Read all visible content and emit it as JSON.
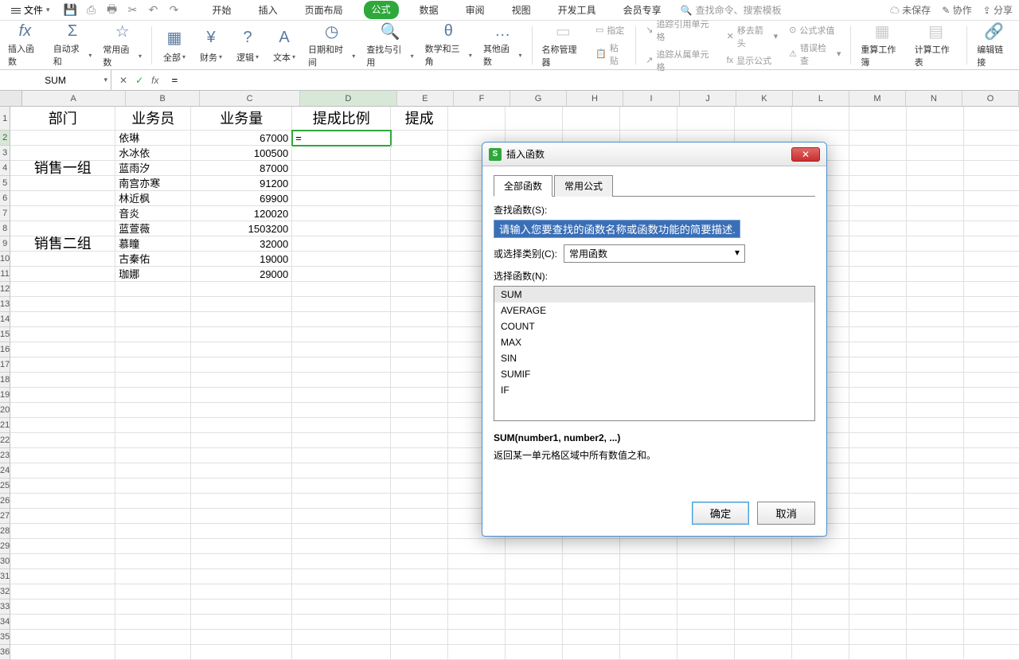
{
  "topbar": {
    "file": "文件",
    "tabs": [
      "开始",
      "插入",
      "页面布局",
      "公式",
      "数据",
      "审阅",
      "视图",
      "开发工具",
      "会员专享"
    ],
    "active_tab_index": 3,
    "search_placeholder": "查找命令、搜索模板",
    "right": {
      "unsaved": "未保存",
      "collab": "协作",
      "share": "分享"
    }
  },
  "ribbon": {
    "insert_fn": "插入函数",
    "autosum": "自动求和",
    "common": "常用函数",
    "all": "全部",
    "finance": "财务",
    "logic": "逻辑",
    "text": "文本",
    "datetime": "日期和时间",
    "lookup": "查找与引用",
    "math": "数学和三角",
    "other": "其他函数",
    "name_mgr": "名称管理器",
    "paste": "粘贴",
    "define": "指定",
    "trace_prec": "追踪引用单元格",
    "trace_dep": "追踪从属单元格",
    "remove_arrows": "移去箭头",
    "show_formula": "显示公式",
    "eval": "公式求值",
    "error_check": "错误检查",
    "calc_book": "重算工作簿",
    "calc_sheet": "计算工作表",
    "edit_link": "编辑链接"
  },
  "fbar": {
    "name": "SUM",
    "formula": "="
  },
  "sheet": {
    "cols": [
      "A",
      "B",
      "C",
      "D",
      "E",
      "F",
      "G",
      "H",
      "I",
      "J",
      "K",
      "L",
      "M",
      "N",
      "O"
    ],
    "header": {
      "A": "部门",
      "B": "业务员",
      "C": "业务量",
      "D": "提成比例",
      "E": "提成"
    },
    "rows": [
      {
        "A": "",
        "B": "依琳",
        "C": "67000",
        "D": "="
      },
      {
        "A": "",
        "B": "水冰依",
        "C": "100500"
      },
      {
        "A": "销售一组",
        "B": "蓝雨汐",
        "C": "87000"
      },
      {
        "A": "",
        "B": "南宫亦寒",
        "C": "91200"
      },
      {
        "A": "",
        "B": "林近枫",
        "C": "69900"
      },
      {
        "A": "",
        "B": "音炎",
        "C": "120020"
      },
      {
        "A": "",
        "B": "蓝萱薇",
        "C": "1503200"
      },
      {
        "A": "销售二组",
        "B": "慕瞳",
        "C": "32000"
      },
      {
        "A": "",
        "B": "古秦佑",
        "C": "19000"
      },
      {
        "A": "",
        "B": "珈娜",
        "C": "29000"
      }
    ],
    "active_cell": "D2"
  },
  "dialog": {
    "title": "插入函数",
    "tabs": [
      "全部函数",
      "常用公式"
    ],
    "active_tab": 0,
    "search_label": "查找函数(S):",
    "search_placeholder": "请输入您要查找的函数名称或函数功能的简要描述...",
    "category_label": "或选择类别(C):",
    "category_value": "常用函数",
    "list_label": "选择函数(N):",
    "functions": [
      "SUM",
      "AVERAGE",
      "COUNT",
      "MAX",
      "SIN",
      "SUMIF",
      "IF"
    ],
    "selected_fn": "SUM",
    "signature": "SUM(number1, number2, ...)",
    "description": "返回某一单元格区域中所有数值之和。",
    "ok": "确定",
    "cancel": "取消"
  }
}
